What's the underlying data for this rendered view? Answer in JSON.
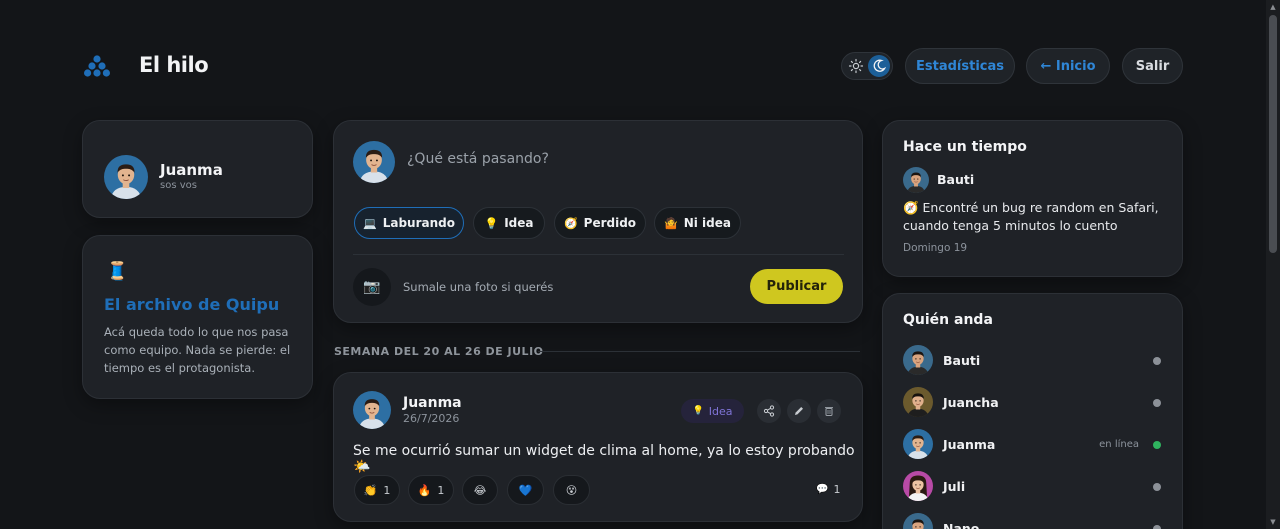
{
  "header": {
    "brand": "El hilo",
    "buttons": {
      "stats": "Estadísticas",
      "home": "← Inicio",
      "exit": "Salir"
    }
  },
  "profile": {
    "name": "Juanma",
    "subtitle": "sos vos"
  },
  "archive": {
    "emoji": "🧵",
    "title": "El archivo de Quipu",
    "text": "Acá queda todo lo que nos pasa como equipo. Nada se pierde: el tiempo es el protagonista."
  },
  "composer": {
    "placeholder": "¿Qué está pasando?",
    "chips": [
      {
        "emoji": "💻",
        "label": "Laburando",
        "active": true
      },
      {
        "emoji": "💡",
        "label": "Idea"
      },
      {
        "emoji": "🧭",
        "label": "Perdido"
      },
      {
        "emoji": "🤷",
        "label": "Ni idea"
      }
    ],
    "photo_icon": "📷",
    "photo_text": "Sumale una foto si querés",
    "publish": "Publicar"
  },
  "week": {
    "label": "SEMANA DEL 20 AL 26 DE JULIO"
  },
  "post": {
    "author": "Juanma",
    "date": "26/7/2026",
    "tag_emoji": "💡",
    "tag": "Idea",
    "actions": [
      "share-icon",
      "edit-icon",
      "delete-icon"
    ],
    "text": "Se me ocurrió sumar un widget de clima al home, ya lo estoy probando 🌤️",
    "reactions": [
      {
        "emoji": "👏",
        "count": "1"
      },
      {
        "emoji": "🔥",
        "count": "1"
      },
      {
        "emoji": "😂",
        "count": ""
      },
      {
        "emoji": "💙",
        "count": ""
      },
      {
        "emoji": "😵",
        "count": ""
      }
    ],
    "comments_icon": "💬",
    "comments": "1"
  },
  "memory": {
    "title": "Hace un tiempo",
    "author": "Bauti",
    "text": "🧭 Encontré un bug re random en Safari, cuando tenga 5 minutos lo cuento",
    "date": "Domingo 19"
  },
  "presence": {
    "title": "Quién anda",
    "members": [
      {
        "name": "Bauti",
        "status": "",
        "online": false
      },
      {
        "name": "Juancha",
        "status": "",
        "online": false
      },
      {
        "name": "Juanma",
        "status": "en línea",
        "online": true
      },
      {
        "name": "Juli",
        "status": "",
        "online": false
      },
      {
        "name": "Nano",
        "status": "",
        "online": false
      }
    ]
  },
  "colors": {
    "accent": "#1f6eb8",
    "publish": "#cfc71f",
    "online": "#2fb35f",
    "background": "#131518",
    "card": "#1f2227"
  }
}
